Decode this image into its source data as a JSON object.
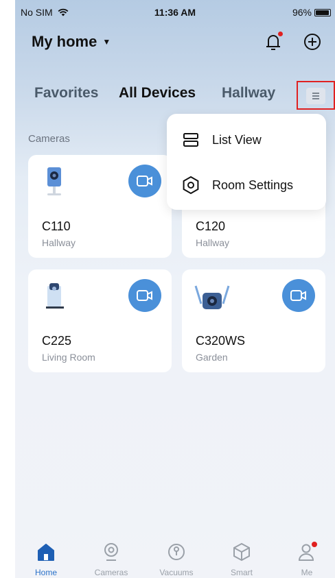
{
  "status_bar": {
    "carrier": "No SIM",
    "time": "11:36 AM",
    "battery": "96%"
  },
  "header": {
    "title": "My home"
  },
  "tabs": [
    {
      "label": "Favorites"
    },
    {
      "label": "All Devices"
    },
    {
      "label": "Hallway"
    }
  ],
  "section": {
    "title": "Cameras"
  },
  "devices": [
    {
      "name": "C110",
      "room": "Hallway"
    },
    {
      "name": "C120",
      "room": "Hallway"
    },
    {
      "name": "C225",
      "room": "Living Room"
    },
    {
      "name": "C320WS",
      "room": "Garden"
    }
  ],
  "menu": {
    "items": [
      {
        "label": "List View"
      },
      {
        "label": "Room Settings"
      }
    ]
  },
  "tabbar": {
    "items": [
      {
        "label": "Home"
      },
      {
        "label": "Cameras"
      },
      {
        "label": "Vacuums"
      },
      {
        "label": "Smart"
      },
      {
        "label": "Me"
      }
    ]
  },
  "colors": {
    "accent": "#4a90d9",
    "active_tab": "#2a72c9",
    "alert": "#e02020"
  }
}
